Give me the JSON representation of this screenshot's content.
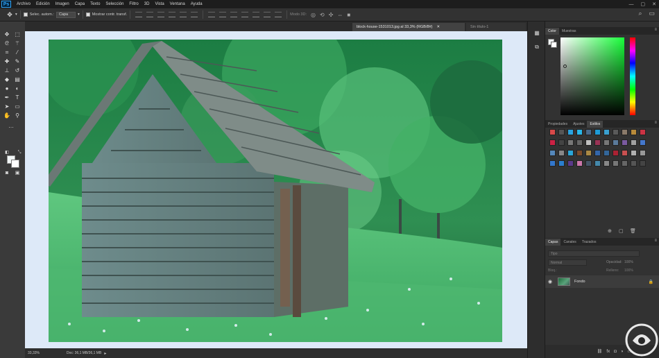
{
  "app": {
    "logo": "Ps"
  },
  "menu": [
    "Archivo",
    "Edición",
    "Imagen",
    "Capa",
    "Texto",
    "Selección",
    "Filtro",
    "3D",
    "Vista",
    "Ventana",
    "Ayuda"
  ],
  "window_controls": [
    "—",
    "▢",
    "✕"
  ],
  "options": {
    "auto_select_label": "Selec. autom.:",
    "auto_select_value": "Capa",
    "transform_label": "Mostrar contr. transf.",
    "mode_3d_label": "Modo 3D:"
  },
  "tabs": [
    {
      "label": "block-house-1531013.jpg al 33,3% (RGB/8#)",
      "close": "✕"
    },
    {
      "label": "Sin título-1",
      "close": ""
    }
  ],
  "status": {
    "zoom": "33,33%",
    "doc": "Doc: 36,1 MB/36,1 MB"
  },
  "panels": {
    "color_tabs": [
      "Color",
      "Muestras"
    ],
    "styles_tabs": [
      "Propiedades",
      "Ajustes",
      "Estilos"
    ],
    "layers_tabs": [
      "Capas",
      "Canales",
      "Trazados"
    ],
    "filter_placeholder": "Tipo",
    "blend_mode": "Normal",
    "opacity_label": "Opacidad:",
    "opacity_value": "100%",
    "lock_label": "Bloq.:",
    "fill_label": "Relleno:",
    "fill_value": "100%",
    "layer_name": "Fondo"
  },
  "colors": {
    "accent": "#31a8ff",
    "canvas_bg": "#dde9f8",
    "foreground": "#f2f7f7",
    "background": "#ffffff",
    "style_swatches": [
      "#d84a4a",
      "#555555",
      "#2aa3e0",
      "#29b6e8",
      "#4a6a8a",
      "#1d9bd6",
      "#3aa0d0",
      "#5a5a5a",
      "#8a7a6a",
      "#b88a3a",
      "#cc3344",
      "#cc2244",
      "#444444",
      "#777777",
      "#666666",
      "#c0c0c0",
      "#993355",
      "#777777",
      "#5a7a9a",
      "#7a5aa0",
      "#a0a0a0",
      "#4477cc",
      "#5588bb",
      "#888888",
      "#2aa6d8",
      "#7a4a2a",
      "#aa8844",
      "#3366aa",
      "#336699",
      "#aa2233",
      "#c85050",
      "#b0b0b0",
      "#999999",
      "#3377cc",
      "#2b7fcf",
      "#5a3a8a",
      "#cc77aa",
      "#445566",
      "#4488aa",
      "#888888",
      "#777777",
      "#666666",
      "#555555",
      "#444444"
    ]
  },
  "icons": {
    "move": "move-icon",
    "marquee": "marquee-icon",
    "lasso": "lasso-icon",
    "wand": "magic-wand-icon",
    "crop": "crop-icon",
    "eyedropper": "eyedropper-icon",
    "heal": "healing-icon",
    "brush": "brush-icon",
    "stamp": "clone-stamp-icon",
    "history": "history-brush-icon",
    "eraser": "eraser-icon",
    "gradient": "gradient-icon",
    "blur": "blur-icon",
    "dodge": "dodge-icon",
    "pen": "pen-icon",
    "type": "type-icon",
    "path": "path-selection-icon",
    "shape": "shape-icon",
    "hand": "hand-icon",
    "zoom": "zoom-icon"
  }
}
